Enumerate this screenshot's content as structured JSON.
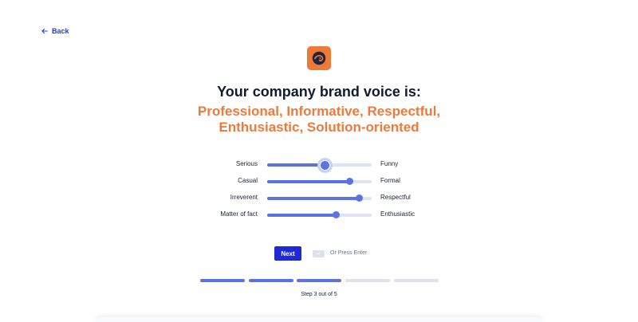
{
  "nav": {
    "back_label": "Back"
  },
  "logo": {
    "icon": "brand-logo-icon",
    "color": "#ee7a36"
  },
  "heading": {
    "title": "Your company brand voice is:",
    "voice_line1": "Professional, Informative, Respectful,",
    "voice_line2": "Enthusiastic, Solution-oriented"
  },
  "sliders": [
    {
      "left": "Serious",
      "right": "Funny",
      "value": 0.55
    },
    {
      "left": "Casual",
      "right": "Formal",
      "value": 0.79
    },
    {
      "left": "Irreverent",
      "right": "Respectful",
      "value": 0.88
    },
    {
      "left": "Matter of fact",
      "right": "Enthusiastic",
      "value": 0.66
    }
  ],
  "actions": {
    "next_label": "Next",
    "enter_hint": "Or Press Enter",
    "enter_icon": "enter-key-icon"
  },
  "progress": {
    "current": 3,
    "total": 5,
    "label": "Step 3 out of 5"
  },
  "colors": {
    "accent": "#5b73e0",
    "primary_button": "#1f2ad6",
    "highlight": "#ec7a3c"
  }
}
